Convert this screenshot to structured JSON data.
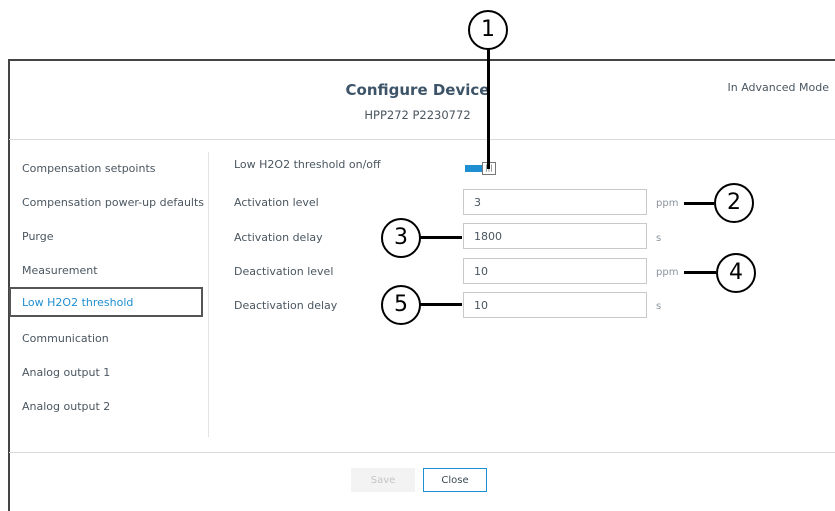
{
  "dialog": {
    "title": "Configure Device",
    "subtitle": "HPP272 P2230772",
    "mode": "In Advanced Mode"
  },
  "sidebar": {
    "items": [
      {
        "label": "Compensation setpoints"
      },
      {
        "label": "Compensation power-up defaults"
      },
      {
        "label": "Purge"
      },
      {
        "label": "Measurement"
      },
      {
        "label": "Low H2O2 threshold",
        "active": true
      },
      {
        "label": "Communication"
      },
      {
        "label": "Analog output 1"
      },
      {
        "label": "Analog output 2"
      }
    ]
  },
  "form": {
    "toggle": {
      "label": "Low H2O2 threshold on/off",
      "state": "on",
      "knob_glyph": "|||"
    },
    "fields": [
      {
        "label": "Activation level",
        "value": "3",
        "unit": "ppm"
      },
      {
        "label": "Activation delay",
        "value": "1800",
        "unit": "s"
      },
      {
        "label": "Deactivation level",
        "value": "10",
        "unit": "ppm"
      },
      {
        "label": "Deactivation delay",
        "value": "10",
        "unit": "s"
      }
    ]
  },
  "footer": {
    "save_label": "Save",
    "close_label": "Close"
  },
  "callouts": [
    "1",
    "2",
    "3",
    "4",
    "5"
  ],
  "colors": {
    "accent": "#1f8fd1",
    "title": "#3d5468",
    "border": "#444444"
  }
}
